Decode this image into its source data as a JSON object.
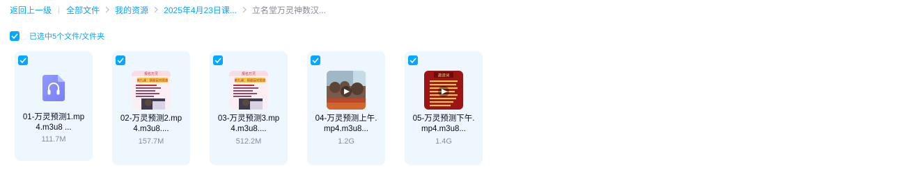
{
  "breadcrumb": {
    "back": "返回上一级",
    "items": [
      "全部文件",
      "我的资源",
      "2025年4月23日课..."
    ],
    "current": "立名堂万灵神数汉..."
  },
  "selection": {
    "checked": true,
    "text": "已选中5个文件/文件夹"
  },
  "files": [
    {
      "name_line1": "01-万灵预测1.mp",
      "name_line2": "4.m3u8 ...",
      "size": "111.7M",
      "thumb": "audio-icon",
      "checked": true
    },
    {
      "name_line1": "02-万灵预测2.mp",
      "name_line2": "4.m3u8....",
      "size": "157.7M",
      "thumb": "video-thumbnail",
      "checked": true
    },
    {
      "name_line1": "03-万灵预测3.mp",
      "name_line2": "4.m3u8....",
      "size": "512.2M",
      "thumb": "video-thumbnail",
      "checked": true
    },
    {
      "name_line1": "04-万灵预测上午.",
      "name_line2": "mp4.m3u8...",
      "size": "1.2G",
      "thumb": "video-thumbnail",
      "checked": true
    },
    {
      "name_line1": "05-万灵预测下午.",
      "name_line2": "mp4.m3u8...",
      "size": "1.4G",
      "thumb": "video-thumbnail",
      "checked": true
    }
  ],
  "thumb_text": {
    "slide_header": "报名万灵",
    "slide_title": "第九课：猜题目对照表",
    "red_title": "邀请词"
  },
  "colors": {
    "accent": "#06a7ff",
    "card_bg": "#eef7fe",
    "muted": "#878c9c",
    "text": "#03081a"
  }
}
